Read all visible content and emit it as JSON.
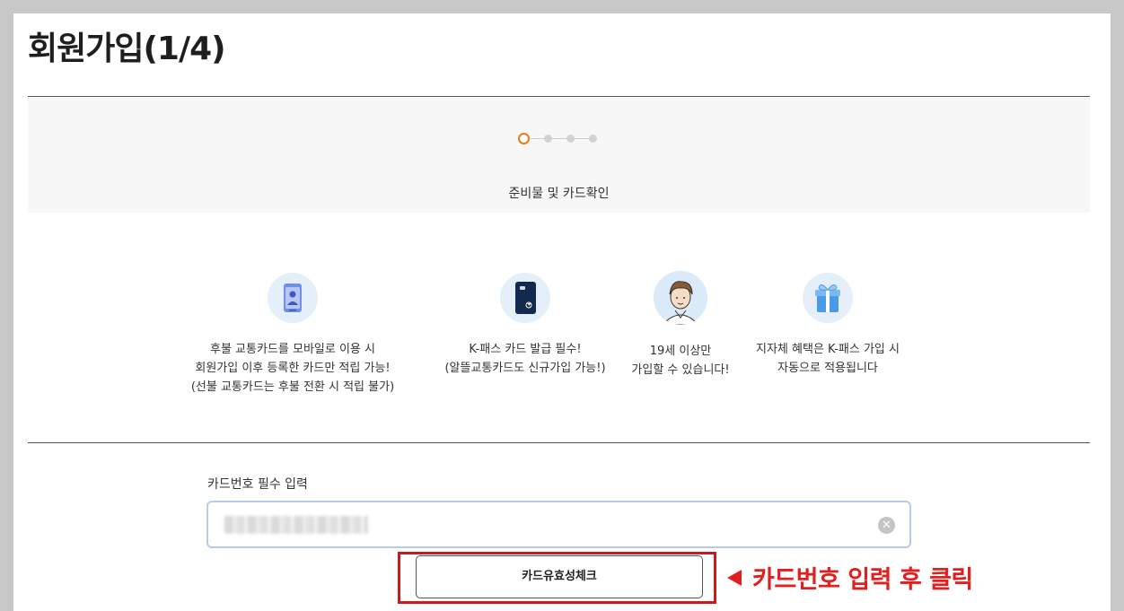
{
  "page": {
    "title": "회원가입(1/4)"
  },
  "stepper": {
    "current_step": 1,
    "total_steps": 4,
    "step_label": "준비물 및 카드확인",
    "active_color": "#ef7a1a"
  },
  "features": [
    {
      "icon": "mobile-phone-card-icon",
      "lines": [
        "후불 교통카드를 모바일로 이용 시",
        "회원가입 이후 등록한 카드만 적립 가능!",
        "(선불 교통카드는 후불 전환 시 적립 불가)"
      ]
    },
    {
      "icon": "kpass-card-icon",
      "lines": [
        "K-패스 카드 발급 필수!",
        "(알뜰교통카드도 신규가입 가능!)"
      ]
    },
    {
      "icon": "person-avatar-icon",
      "lines": [
        "19세 이상만",
        "가입할 수 있습니다!"
      ]
    },
    {
      "icon": "gift-box-icon",
      "lines": [
        "지자체 혜택은 K-패스 가입 시",
        "자동으로 적용됩니다"
      ]
    }
  ],
  "card_form": {
    "label": "카드번호 필수 입력",
    "button_label": "카드유효성체크"
  },
  "annotation": {
    "text": "카드번호 입력 후 클릭",
    "color": "#e21e1e"
  }
}
